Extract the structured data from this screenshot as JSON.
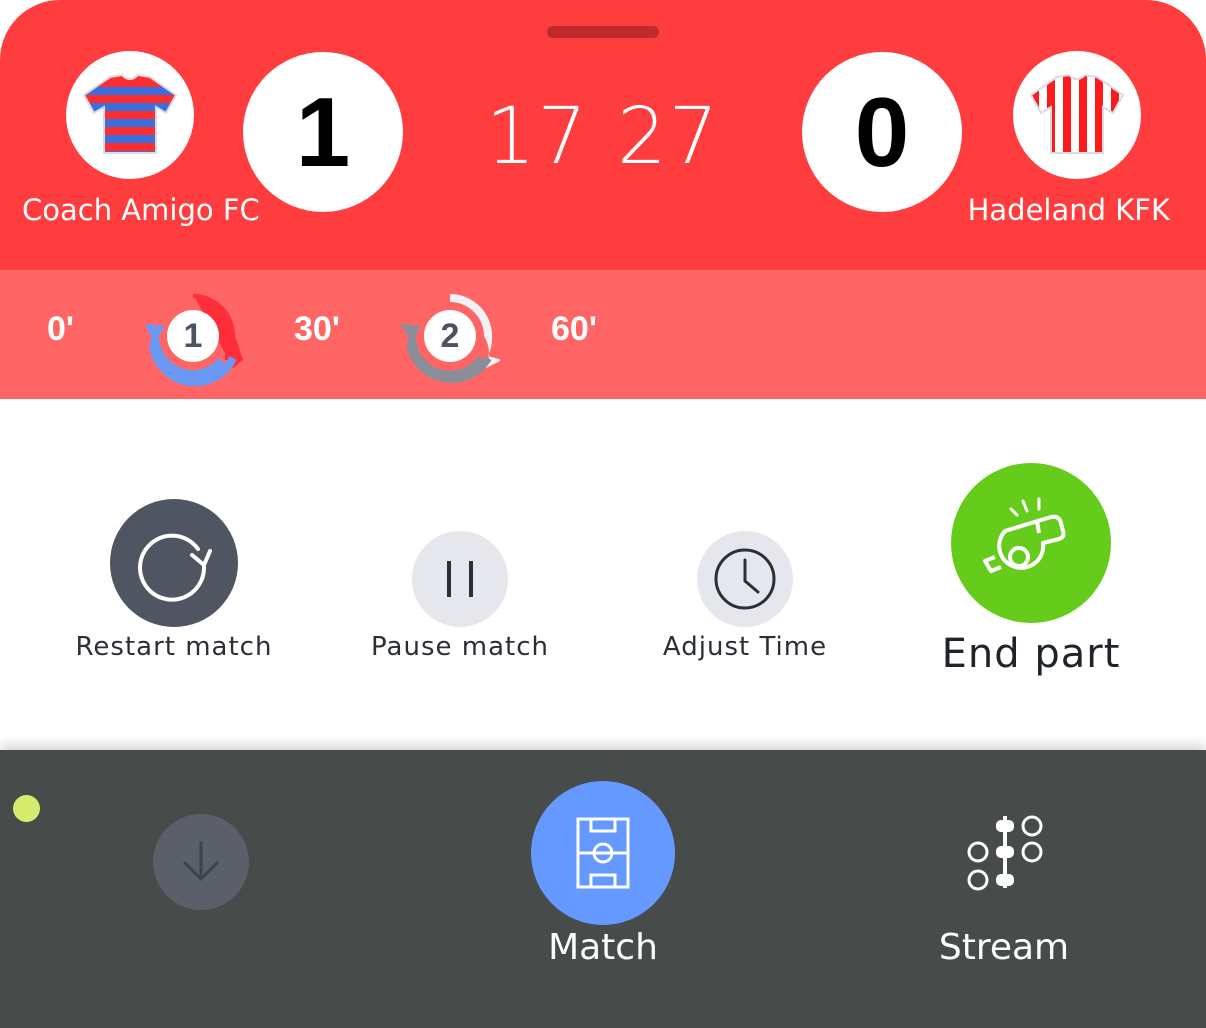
{
  "match": {
    "home_team": "Coach Amigo FC",
    "away_team": "Hadeland KFK",
    "home_score": "1",
    "away_score": "0",
    "clock_minutes": "17",
    "clock_seconds": "27"
  },
  "timeline": {
    "ticks": [
      "0'",
      "30'",
      "60'"
    ],
    "periods": [
      "1",
      "2"
    ]
  },
  "controls": {
    "restart": "Restart match",
    "pause": "Pause match",
    "adjust": "Adjust Time",
    "end": "End part"
  },
  "nav": {
    "match": "Match",
    "stream": "Stream"
  },
  "colors": {
    "header": "#ff3d3f",
    "timeline": "#ff6564",
    "end_part": "#66cc1c",
    "match_active": "#6699ff",
    "bottom_bar": "#474b49",
    "status_dot": "#d7ec6d"
  },
  "icons": {
    "home_crest": "shirt-blue-red-stripes-icon",
    "away_crest": "shirt-red-white-stripes-icon",
    "restart": "restart-icon",
    "pause": "pause-icon",
    "adjust": "clock-icon",
    "end": "whistle-icon",
    "collapse": "arrow-down-icon",
    "match": "pitch-icon",
    "stream": "stream-icon"
  }
}
